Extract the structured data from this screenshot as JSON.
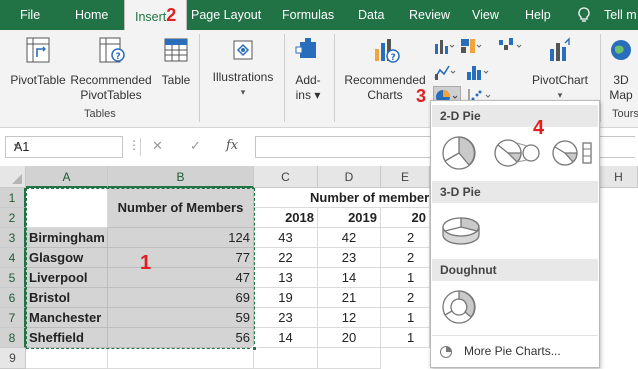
{
  "ribbon_tabs": [
    {
      "label": "File"
    },
    {
      "label": "Home"
    },
    {
      "label": "Insert",
      "step": "2"
    },
    {
      "label": "Page Layout"
    },
    {
      "label": "Formulas"
    },
    {
      "label": "Data"
    },
    {
      "label": "Review"
    },
    {
      "label": "View"
    },
    {
      "label": "Help"
    },
    {
      "label": "Tell m"
    }
  ],
  "ribbon": {
    "pivottable": "PivotTable",
    "recommended_pivottables_1": "Recommended",
    "recommended_pivottables_2": "PivotTables",
    "table": "Table",
    "tables_group": "Tables",
    "illustrations": "Illustrations",
    "illustrations_dropdown": "▾",
    "addins_1": "Add-",
    "addins_2": "ins ▾",
    "recommended_charts_1": "Recommended",
    "recommended_charts_2": "Charts",
    "pivotchart": "PivotChart",
    "pivotchart_dropdown": "▾",
    "map3d_1": "3D",
    "map3d_2": "Map",
    "tours": "Tours",
    "step3": "3"
  },
  "formula_bar": {
    "name_box": "A1",
    "formula": ""
  },
  "grid": {
    "columns": [
      "A",
      "B",
      "C",
      "D",
      "E",
      "H"
    ],
    "rows": [
      "1",
      "2",
      "3",
      "4",
      "5",
      "6",
      "7",
      "8",
      "9"
    ],
    "b_header": "Number of Members",
    "group_header": "Number of member",
    "year_headers": [
      "2018",
      "2019",
      "20"
    ],
    "data_rows": [
      {
        "city": "Birmingham",
        "members": "124",
        "y2018": "43",
        "y2019": "42",
        "y20": "2"
      },
      {
        "city": "Glasgow",
        "members": "77",
        "y2018": "22",
        "y2019": "23",
        "y20": "2"
      },
      {
        "city": "Liverpool",
        "members": "47",
        "y2018": "13",
        "y2019": "14",
        "y20": "1"
      },
      {
        "city": "Bristol",
        "members": "69",
        "y2018": "19",
        "y2019": "21",
        "y20": "2"
      },
      {
        "city": "Manchester",
        "members": "59",
        "y2018": "23",
        "y2019": "12",
        "y20": "1"
      },
      {
        "city": "Sheffield",
        "members": "56",
        "y2018": "14",
        "y2019": "20",
        "y20": "1"
      }
    ],
    "step1": "1"
  },
  "chart_menu": {
    "section_2d": "2-D Pie",
    "section_3d": "3-D Pie",
    "section_doughnut": "Doughnut",
    "more": "More Pie Charts...",
    "step4": "4",
    "items_2d": [
      {
        "icon": "pie-chart-icon"
      },
      {
        "icon": "pie-of-pie-chart-icon"
      },
      {
        "icon": "bar-of-pie-chart-icon"
      }
    ],
    "items_3d": [
      {
        "icon": "3d-pie-chart-icon"
      }
    ],
    "items_doughnut": [
      {
        "icon": "doughnut-chart-icon"
      }
    ]
  },
  "colors": {
    "ribbon_green": "#217346",
    "annotation_red": "#e02020",
    "selection_gray": "#d4d4d4"
  }
}
